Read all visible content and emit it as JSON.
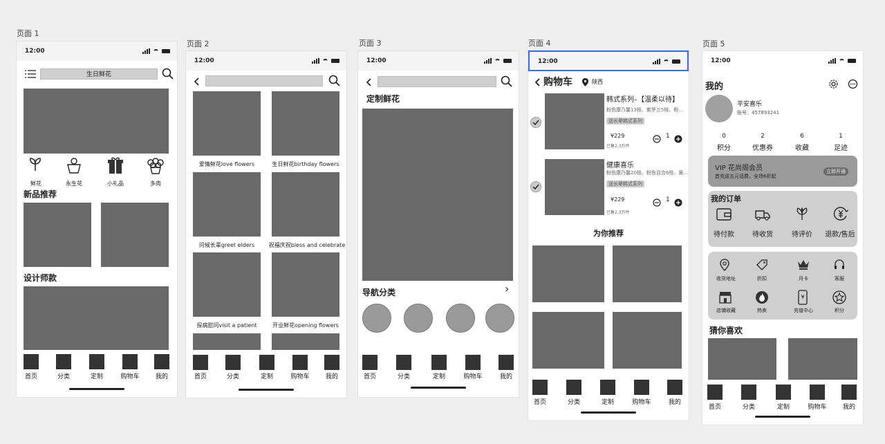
{
  "status_time": "12:00",
  "page_labels": [
    "页面 1",
    "页面 2",
    "页面 3",
    "页面 4",
    "页面 5"
  ],
  "tabs": [
    "首页",
    "分类",
    "定制",
    "购物车",
    "我的"
  ],
  "p1": {
    "search_text": "生日鲜花",
    "categories": [
      "鲜花",
      "永生花",
      "小礼品",
      "多肉"
    ],
    "new_title": "新品推荐",
    "designer_title": "设计师款"
  },
  "p2": {
    "captions": [
      "爱情鲜花love flowers",
      "生日鲜花birthday flowers",
      "问候长辈greet elders",
      "祝福庆祝bless and celebrate",
      "探病慰问visit a patient",
      "开业鲜花opening flowers"
    ]
  },
  "p3": {
    "title": "定制鲜花",
    "nav_title": "导航分类",
    "nav_arrow": "›"
  },
  "p4": {
    "title": "购物车",
    "location": "陕西",
    "items": [
      {
        "name": "韩式系列–【温柔以待】",
        "desc": "粉色康乃馨13枝、紫罗兰5枝、粉…",
        "tag": "送长辈韩式系列",
        "price": "¥229",
        "sold": "已售2.3万件",
        "qty": "1"
      },
      {
        "name": "健康喜乐",
        "desc": "粉色康乃馨20枝、粉色百合6枝、黄…",
        "tag": "送长辈韩式系列",
        "price": "¥229",
        "sold": "已售2.3万件",
        "qty": "1"
      }
    ],
    "recommend_title": "为你推荐"
  },
  "p5": {
    "title": "我的",
    "username": "平安喜乐",
    "account": "账号：457893241",
    "stats": [
      {
        "num": "0",
        "label": "积分"
      },
      {
        "num": "2",
        "label": "优惠券"
      },
      {
        "num": "6",
        "label": "收藏"
      },
      {
        "num": "1",
        "label": "足迹"
      }
    ],
    "vip_title": "VIP 花尚阁会员",
    "vip_sub": "首充送五元话费，全场6折起",
    "vip_btn": "立即开通",
    "orders_title": "我的订单",
    "orders": [
      "待付款",
      "待收货",
      "待评价",
      "退款/售后"
    ],
    "services": [
      "收货地址",
      "折扣",
      "月卡",
      "客服",
      "店铺收藏",
      "热卖",
      "充值中心",
      "积分"
    ],
    "guess_title": "猜你喜欢"
  }
}
